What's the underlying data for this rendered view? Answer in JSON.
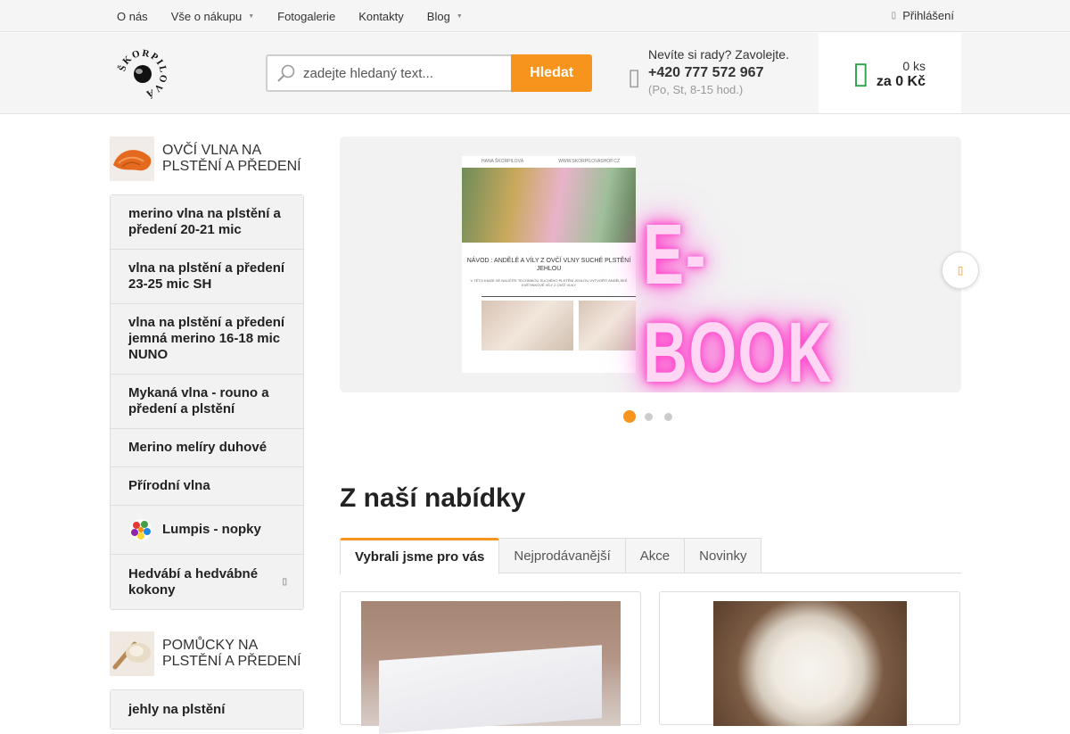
{
  "topnav": {
    "items": [
      {
        "label": "O nás",
        "has_dropdown": false
      },
      {
        "label": "Vše o nákupu",
        "has_dropdown": true
      },
      {
        "label": "Fotogalerie",
        "has_dropdown": false
      },
      {
        "label": "Kontakty",
        "has_dropdown": false
      },
      {
        "label": "Blog",
        "has_dropdown": true
      }
    ],
    "login_label": "Přihlášení"
  },
  "header": {
    "logo_text": "ŠKORPILOVÁ",
    "search": {
      "placeholder": "zadejte hledaný text...",
      "button_label": "Hledat"
    },
    "phone": {
      "question": "Nevíte si rady? Zavolejte.",
      "number": "+420 777 572 967",
      "hours": "(Po, St, 8-15 hod.)"
    },
    "cart": {
      "count": "0 ks",
      "total": "za 0 Kč"
    }
  },
  "sidebar": {
    "category1": {
      "title": "OVČÍ VLNA NA PLSTĚNÍ A PŘEDENÍ",
      "items": [
        {
          "label": "merino vlna na plstění a předení 20-21 mic"
        },
        {
          "label": "vlna na plstění a předení 23-25 mic SH"
        },
        {
          "label": "vlna na plstění a předení jemná merino 16-18 mic NUNO"
        },
        {
          "label": "Mykaná vlna - rouno a předení a plstění"
        },
        {
          "label": "Merino melíry duhové"
        },
        {
          "label": "Přírodní vlna"
        },
        {
          "label": "Lumpis - nopky"
        },
        {
          "label": "Hedvábí a hedvábné kokony"
        }
      ]
    },
    "category2": {
      "title": "POMŮCKY NA PLSTĚNÍ A PŘEDENÍ",
      "items": [
        {
          "label": "jehly na plstění"
        }
      ]
    }
  },
  "banner": {
    "book_header_left": "HANA ŠKORPILOVÁ",
    "book_header_right": "WWW.SKORPILOVASHOP.CZ",
    "book_title": "NÁVOD : ANDĚLÉ A VÍLY Z OVČÍ VLNY SUCHÉ PLSTĚNÍ JEHLOU",
    "book_subtitle": "V TÉTO KNIZE SE NAUČÍTE TECHNIKOU SUCHÉHO PLSTĚNÍ JEHLOU VYTVOŘIT ANDĚLSKÉ KVĚTINKOVÉ VÍLY Z OVČÍ VLNY",
    "headline": "E-BOOK",
    "slides_total": 3,
    "active_slide": 1
  },
  "offers": {
    "title": "Z naší nabídky",
    "tabs": [
      {
        "label": "Vybrali jsme pro vás",
        "active": true
      },
      {
        "label": "Nejprodávanější",
        "active": false
      },
      {
        "label": "Akce",
        "active": false
      },
      {
        "label": "Novinky",
        "active": false
      }
    ]
  },
  "colors": {
    "accent": "#f7941d",
    "cart_icon": "#2aa44a",
    "background_bar": "#f5f5f5"
  }
}
